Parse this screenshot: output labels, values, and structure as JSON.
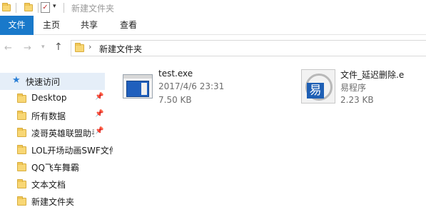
{
  "window": {
    "title": "新建文件夹"
  },
  "ribbon": {
    "tabs": [
      {
        "label": "文件"
      },
      {
        "label": "主页"
      },
      {
        "label": "共享"
      },
      {
        "label": "查看"
      }
    ]
  },
  "address": {
    "path": "新建文件夹"
  },
  "navpane": {
    "quick_access": "快速访问",
    "items": [
      {
        "label": "Desktop",
        "pinned": true
      },
      {
        "label": "所有数据",
        "pinned": true
      },
      {
        "label": "凌哥英雄联盟助手",
        "pinned": true
      },
      {
        "label": "LOL开场动画SWF文件",
        "pinned": false
      },
      {
        "label": "QQ飞车舞霸",
        "pinned": false
      },
      {
        "label": "文本文档",
        "pinned": false
      },
      {
        "label": "新建文件夹",
        "pinned": false
      }
    ]
  },
  "files": [
    {
      "name": "test.exe",
      "date": "2017/4/6 23:31",
      "size": "7.50 KB",
      "icon": "exe-window-icon"
    },
    {
      "name": "文件_延迟删除.e",
      "type": "易程序",
      "size": "2.23 KB",
      "icon": "easy-language-icon"
    }
  ],
  "colors": {
    "accent": "#1979ca",
    "folder": "#f8d775",
    "selection": "#e5eef8"
  }
}
